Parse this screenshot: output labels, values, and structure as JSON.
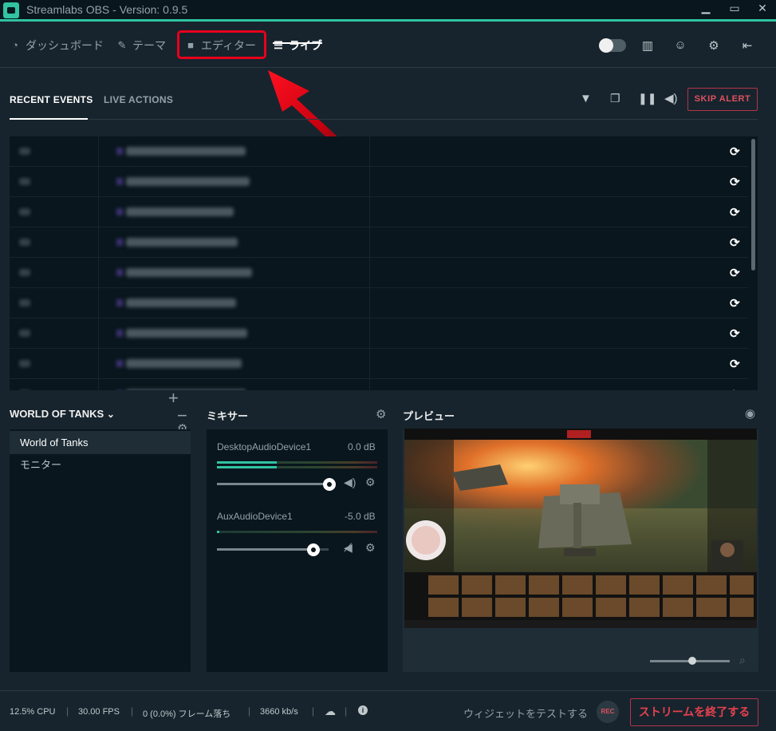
{
  "app": {
    "title": "Streamlabs OBS - Version: 0.9.5"
  },
  "window_controls": [
    "minimize",
    "maximize",
    "close"
  ],
  "nav": {
    "items": [
      {
        "label": "ダッシュボード",
        "icon": "dashboard-icon",
        "active": false
      },
      {
        "label": "テーマ",
        "icon": "theme-icon",
        "active": false
      },
      {
        "label": "エディター",
        "icon": "camera-icon",
        "active": false,
        "highlighted": true
      },
      {
        "label": "ライブ",
        "icon": "list-icon",
        "active": true
      }
    ],
    "right_icons": [
      "night-mode-toggle",
      "studio-mode-icon",
      "discord-icon",
      "settings-icon",
      "sidebar-collapse-icon"
    ]
  },
  "events": {
    "tabs": [
      "RECENT EVENTS",
      "LIVE ACTIONS"
    ],
    "active_tab": "RECENT EVENTS",
    "toolbar_icons": [
      "filter-icon",
      "popout-icon",
      "pause-icon",
      "volume-icon"
    ],
    "skip_label": "SKIP ALERT",
    "rows_blurred": 9
  },
  "scenes": {
    "title": "WORLD OF TANKS",
    "items": [
      {
        "label": "World of Tanks",
        "selected": true
      },
      {
        "label": "モニター",
        "selected": false
      }
    ]
  },
  "mixer": {
    "title": "ミキサー",
    "sources": [
      {
        "name": "DesktopAudioDevice1",
        "db": "0.0 dB",
        "volume": 1.0,
        "muted": false
      },
      {
        "name": "AuxAudioDevice1",
        "db": "-5.0 dB",
        "volume": 0.87,
        "muted": true
      }
    ]
  },
  "preview": {
    "title": "プレビュー"
  },
  "status": {
    "cpu": "12.5% CPU",
    "fps": "30.00 FPS",
    "dropped": "0 (0.0%) フレーム落ち",
    "bitrate": "3660 kb/s",
    "test_widgets": "ウィジェットをテストする",
    "rec_label": "REC",
    "end_stream": "ストリームを終了する"
  },
  "colors": {
    "accent": "#31c3a2",
    "highlight_box": "#e8001c",
    "danger": "#e8404f"
  }
}
